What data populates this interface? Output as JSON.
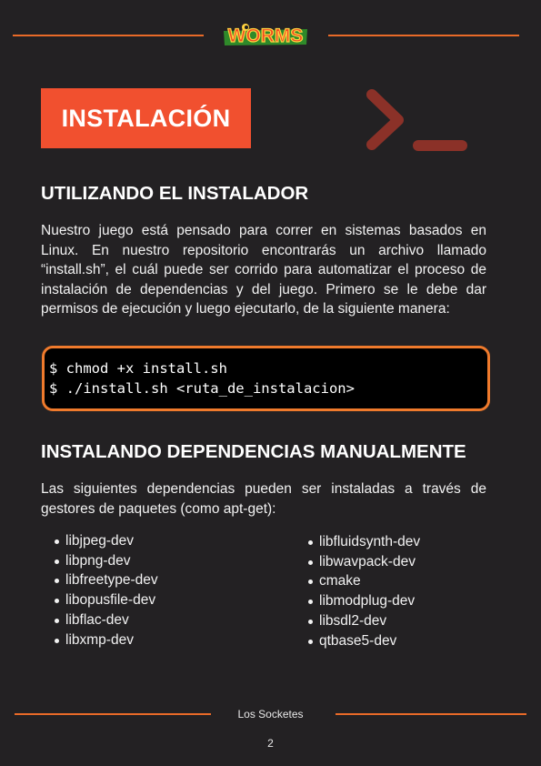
{
  "header": {
    "logo_text": "WORMS"
  },
  "section_title": "INSTALACIÓN",
  "installer": {
    "heading": "UTILIZANDO EL INSTALADOR",
    "paragraph": "Nuestro juego está pensado para correr en sistemas basados en Linux. En nuestro repositorio encontrarás un archivo llamado “install.sh”, el cuál puede ser corrido para automatizar el proceso de instalación de dependencias y del juego. Primero se le debe dar permisos de ejecución y luego ejecutarlo, de la siguiente manera:",
    "code_lines": [
      "$ chmod +x install.sh",
      "$ ./install.sh <ruta_de_instalacion>"
    ]
  },
  "dependencies": {
    "heading": "INSTALANDO DEPENDENCIAS MANUALMENTE",
    "paragraph": "Las siguientes dependencias pueden ser instaladas a través de gestores de paquetes (como apt-get):",
    "left_column": [
      "libjpeg-dev",
      "libpng-dev",
      "libfreetype-dev",
      "libopusfile-dev",
      "libflac-dev",
      "libxmp-dev"
    ],
    "right_column": [
      "libfluidsynth-dev",
      "libwavpack-dev",
      "cmake",
      "libmodplug-dev",
      "libsdl2-dev",
      "qtbase5-dev"
    ]
  },
  "footer": {
    "team": "Los Socketes",
    "page_number": "2"
  },
  "colors": {
    "background": "#232123",
    "accent": "#e86a28",
    "title_box": "#f1502f",
    "terminal_icon": "#8b3128"
  },
  "icons": {
    "terminal": "terminal-prompt-icon"
  }
}
